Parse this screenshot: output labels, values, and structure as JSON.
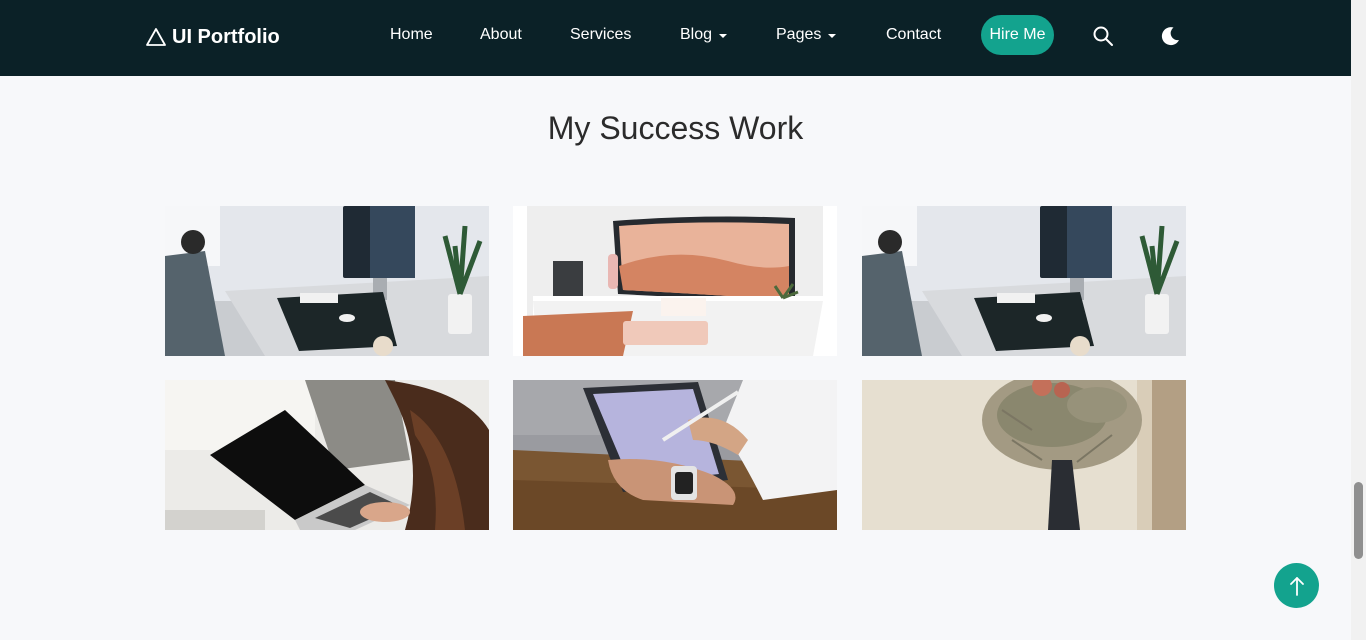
{
  "brand": {
    "name": "UI Portfolio",
    "icon": "triangle-logo-icon"
  },
  "nav": {
    "home": "Home",
    "about": "About",
    "services": "Services",
    "blog": "Blog",
    "pages": "Pages",
    "contact": "Contact",
    "hire": "Hire Me"
  },
  "icons": {
    "search": "search-icon",
    "theme": "moon-icon",
    "back_to_top": "arrow-up-icon"
  },
  "section": {
    "title": "My Success Work"
  },
  "colors": {
    "navbar": "#0b2127",
    "accent": "#13a38e",
    "page_bg": "#f7f8fa",
    "title": "#2b2b2b"
  },
  "gallery": [
    {
      "subject": "desk with imac and plant"
    },
    {
      "subject": "curved monitor on white desk"
    },
    {
      "subject": "desk with imac and plant"
    },
    {
      "subject": "woman using laptop"
    },
    {
      "subject": "hands drawing on tablet"
    },
    {
      "subject": "dried flowers in vase"
    }
  ]
}
